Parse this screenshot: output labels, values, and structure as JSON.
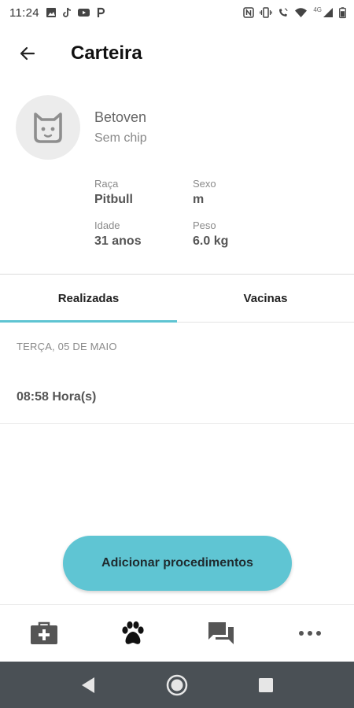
{
  "status_bar": {
    "time": "11:24",
    "notification_icons": [
      "image-icon",
      "tiktok-icon",
      "youtube-icon",
      "p-icon"
    ],
    "system_icons": [
      "nfc-icon",
      "vibrate-icon",
      "call-wifi-icon",
      "wifi-icon",
      "4g-signal-icon",
      "battery-icon"
    ],
    "network_label": "4G"
  },
  "app_bar": {
    "title": "Carteira"
  },
  "pet": {
    "name": "Betoven",
    "chip_status": "Sem chip",
    "details": {
      "breed_label": "Raça",
      "breed_value": "Pitbull",
      "sex_label": "Sexo",
      "sex_value": "m",
      "age_label": "Idade",
      "age_value": "31 anos",
      "weight_label": "Peso",
      "weight_value": "6.0 kg"
    }
  },
  "tabs": [
    {
      "label": "Realizadas",
      "active": true
    },
    {
      "label": "Vacinas",
      "active": false
    }
  ],
  "records": {
    "date_heading": "TERÇA, 05 DE MAIO",
    "entries": [
      {
        "time": "08:58 Hora(s)"
      }
    ]
  },
  "add_button": {
    "label": "Adicionar procedimentos",
    "color": "#5fc5d3"
  },
  "bottom_nav": {
    "items": [
      "medical-kit-icon",
      "paw-icon",
      "chat-icon",
      "more-icon"
    ],
    "active_index": 1
  },
  "colors": {
    "accent": "#5ec4d2",
    "system_nav": "#4a5055"
  }
}
